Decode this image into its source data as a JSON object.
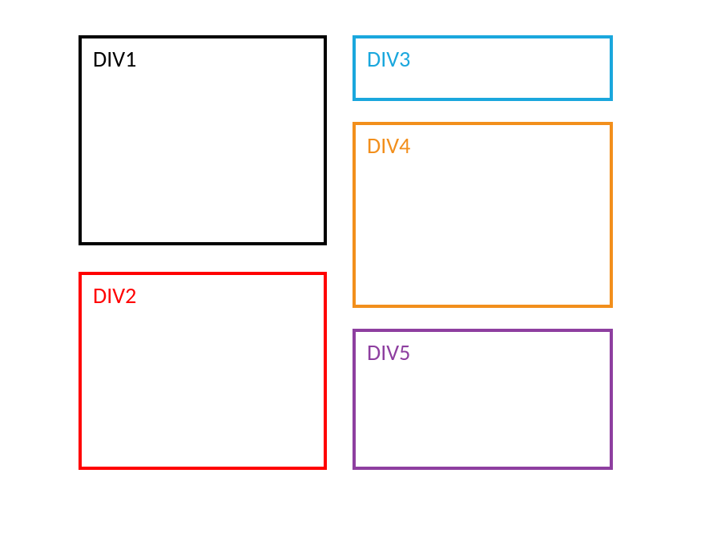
{
  "boxes": {
    "div1": {
      "label": "DIV1",
      "color": "#000000"
    },
    "div2": {
      "label": "DIV2",
      "color": "#ff0000"
    },
    "div3": {
      "label": "DIV3",
      "color": "#1aa7dd"
    },
    "div4": {
      "label": "DIV4",
      "color": "#f28f1c"
    },
    "div5": {
      "label": "DIV5",
      "color": "#8e3fa0"
    }
  }
}
